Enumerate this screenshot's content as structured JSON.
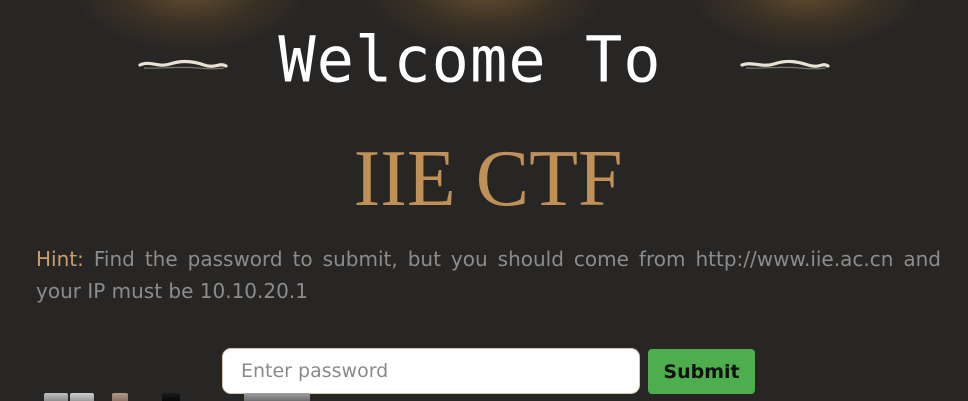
{
  "header": {
    "title": "Welcome To",
    "brand": "IIE CTF"
  },
  "hint": {
    "label": "Hint:",
    "text": "Find the password to submit, but you should come from http://www.iie.ac.cn and your IP must be 10.10.20.1"
  },
  "form": {
    "password_placeholder": "Enter password",
    "password_value": "",
    "submit_label": "Submit"
  },
  "colors": {
    "background": "#282624",
    "brand": "#bf9158",
    "hint_label": "#c9a06c",
    "hint_text": "#8c8c8c",
    "submit_bg": "#4cae4c"
  }
}
